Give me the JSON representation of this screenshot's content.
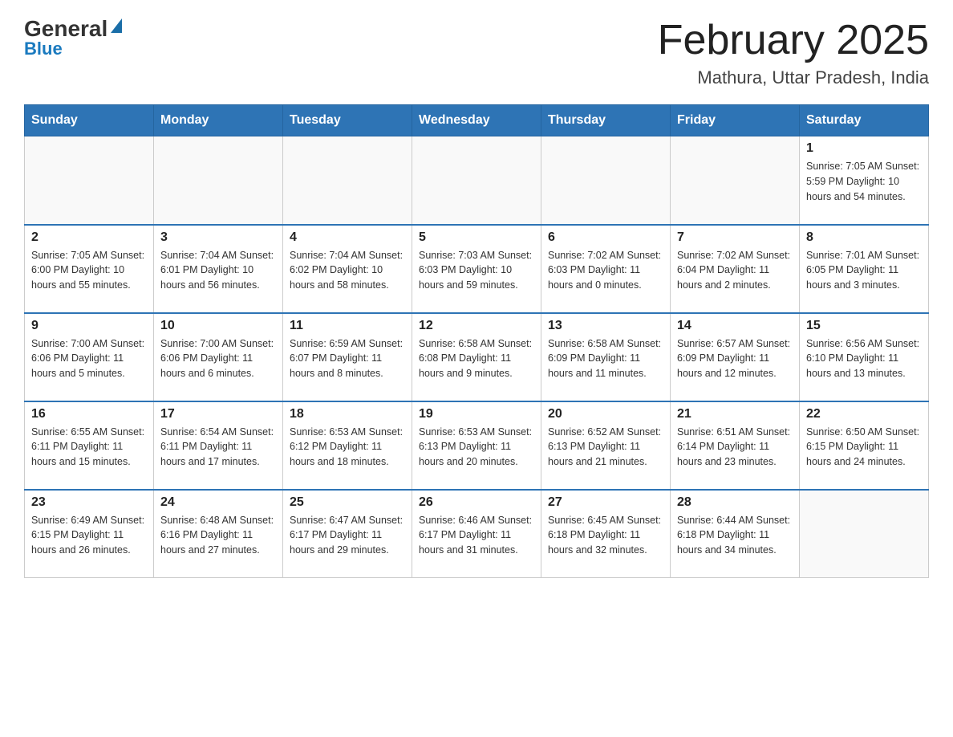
{
  "logo": {
    "general": "General",
    "blue": "Blue"
  },
  "title": "February 2025",
  "subtitle": "Mathura, Uttar Pradesh, India",
  "days_of_week": [
    "Sunday",
    "Monday",
    "Tuesday",
    "Wednesday",
    "Thursday",
    "Friday",
    "Saturday"
  ],
  "weeks": [
    [
      {
        "day": "",
        "info": ""
      },
      {
        "day": "",
        "info": ""
      },
      {
        "day": "",
        "info": ""
      },
      {
        "day": "",
        "info": ""
      },
      {
        "day": "",
        "info": ""
      },
      {
        "day": "",
        "info": ""
      },
      {
        "day": "1",
        "info": "Sunrise: 7:05 AM\nSunset: 5:59 PM\nDaylight: 10 hours and 54 minutes."
      }
    ],
    [
      {
        "day": "2",
        "info": "Sunrise: 7:05 AM\nSunset: 6:00 PM\nDaylight: 10 hours and 55 minutes."
      },
      {
        "day": "3",
        "info": "Sunrise: 7:04 AM\nSunset: 6:01 PM\nDaylight: 10 hours and 56 minutes."
      },
      {
        "day": "4",
        "info": "Sunrise: 7:04 AM\nSunset: 6:02 PM\nDaylight: 10 hours and 58 minutes."
      },
      {
        "day": "5",
        "info": "Sunrise: 7:03 AM\nSunset: 6:03 PM\nDaylight: 10 hours and 59 minutes."
      },
      {
        "day": "6",
        "info": "Sunrise: 7:02 AM\nSunset: 6:03 PM\nDaylight: 11 hours and 0 minutes."
      },
      {
        "day": "7",
        "info": "Sunrise: 7:02 AM\nSunset: 6:04 PM\nDaylight: 11 hours and 2 minutes."
      },
      {
        "day": "8",
        "info": "Sunrise: 7:01 AM\nSunset: 6:05 PM\nDaylight: 11 hours and 3 minutes."
      }
    ],
    [
      {
        "day": "9",
        "info": "Sunrise: 7:00 AM\nSunset: 6:06 PM\nDaylight: 11 hours and 5 minutes."
      },
      {
        "day": "10",
        "info": "Sunrise: 7:00 AM\nSunset: 6:06 PM\nDaylight: 11 hours and 6 minutes."
      },
      {
        "day": "11",
        "info": "Sunrise: 6:59 AM\nSunset: 6:07 PM\nDaylight: 11 hours and 8 minutes."
      },
      {
        "day": "12",
        "info": "Sunrise: 6:58 AM\nSunset: 6:08 PM\nDaylight: 11 hours and 9 minutes."
      },
      {
        "day": "13",
        "info": "Sunrise: 6:58 AM\nSunset: 6:09 PM\nDaylight: 11 hours and 11 minutes."
      },
      {
        "day": "14",
        "info": "Sunrise: 6:57 AM\nSunset: 6:09 PM\nDaylight: 11 hours and 12 minutes."
      },
      {
        "day": "15",
        "info": "Sunrise: 6:56 AM\nSunset: 6:10 PM\nDaylight: 11 hours and 13 minutes."
      }
    ],
    [
      {
        "day": "16",
        "info": "Sunrise: 6:55 AM\nSunset: 6:11 PM\nDaylight: 11 hours and 15 minutes."
      },
      {
        "day": "17",
        "info": "Sunrise: 6:54 AM\nSunset: 6:11 PM\nDaylight: 11 hours and 17 minutes."
      },
      {
        "day": "18",
        "info": "Sunrise: 6:53 AM\nSunset: 6:12 PM\nDaylight: 11 hours and 18 minutes."
      },
      {
        "day": "19",
        "info": "Sunrise: 6:53 AM\nSunset: 6:13 PM\nDaylight: 11 hours and 20 minutes."
      },
      {
        "day": "20",
        "info": "Sunrise: 6:52 AM\nSunset: 6:13 PM\nDaylight: 11 hours and 21 minutes."
      },
      {
        "day": "21",
        "info": "Sunrise: 6:51 AM\nSunset: 6:14 PM\nDaylight: 11 hours and 23 minutes."
      },
      {
        "day": "22",
        "info": "Sunrise: 6:50 AM\nSunset: 6:15 PM\nDaylight: 11 hours and 24 minutes."
      }
    ],
    [
      {
        "day": "23",
        "info": "Sunrise: 6:49 AM\nSunset: 6:15 PM\nDaylight: 11 hours and 26 minutes."
      },
      {
        "day": "24",
        "info": "Sunrise: 6:48 AM\nSunset: 6:16 PM\nDaylight: 11 hours and 27 minutes."
      },
      {
        "day": "25",
        "info": "Sunrise: 6:47 AM\nSunset: 6:17 PM\nDaylight: 11 hours and 29 minutes."
      },
      {
        "day": "26",
        "info": "Sunrise: 6:46 AM\nSunset: 6:17 PM\nDaylight: 11 hours and 31 minutes."
      },
      {
        "day": "27",
        "info": "Sunrise: 6:45 AM\nSunset: 6:18 PM\nDaylight: 11 hours and 32 minutes."
      },
      {
        "day": "28",
        "info": "Sunrise: 6:44 AM\nSunset: 6:18 PM\nDaylight: 11 hours and 34 minutes."
      },
      {
        "day": "",
        "info": ""
      }
    ]
  ]
}
